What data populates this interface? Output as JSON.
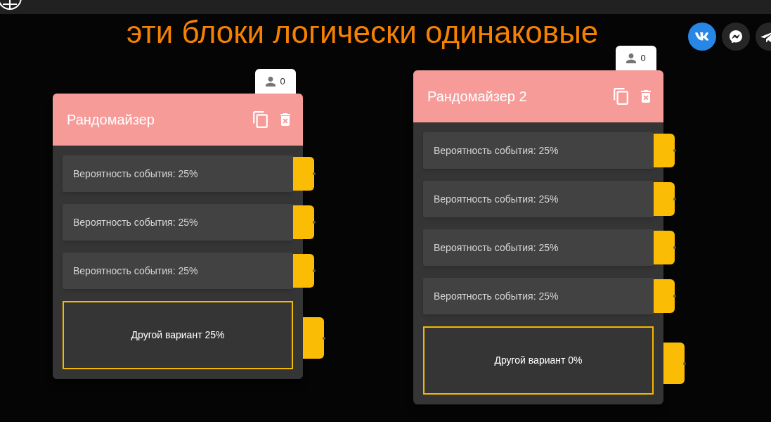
{
  "heading": "эти блоки логически одинаковые",
  "nodes": [
    {
      "title": "Рандомайзер",
      "user_count": "0",
      "outcomes": [
        "Вероятность события: 25%",
        "Вероятность события: 25%",
        "Вероятность события: 25%"
      ],
      "fallback": "Другой вариант 25%"
    },
    {
      "title": "Рандомайзер 2",
      "user_count": "0",
      "outcomes": [
        "Вероятность события: 25%",
        "Вероятность события: 25%",
        "Вероятность события: 25%",
        "Вероятность события: 25%"
      ],
      "fallback": "Другой вариант 0%"
    }
  ]
}
